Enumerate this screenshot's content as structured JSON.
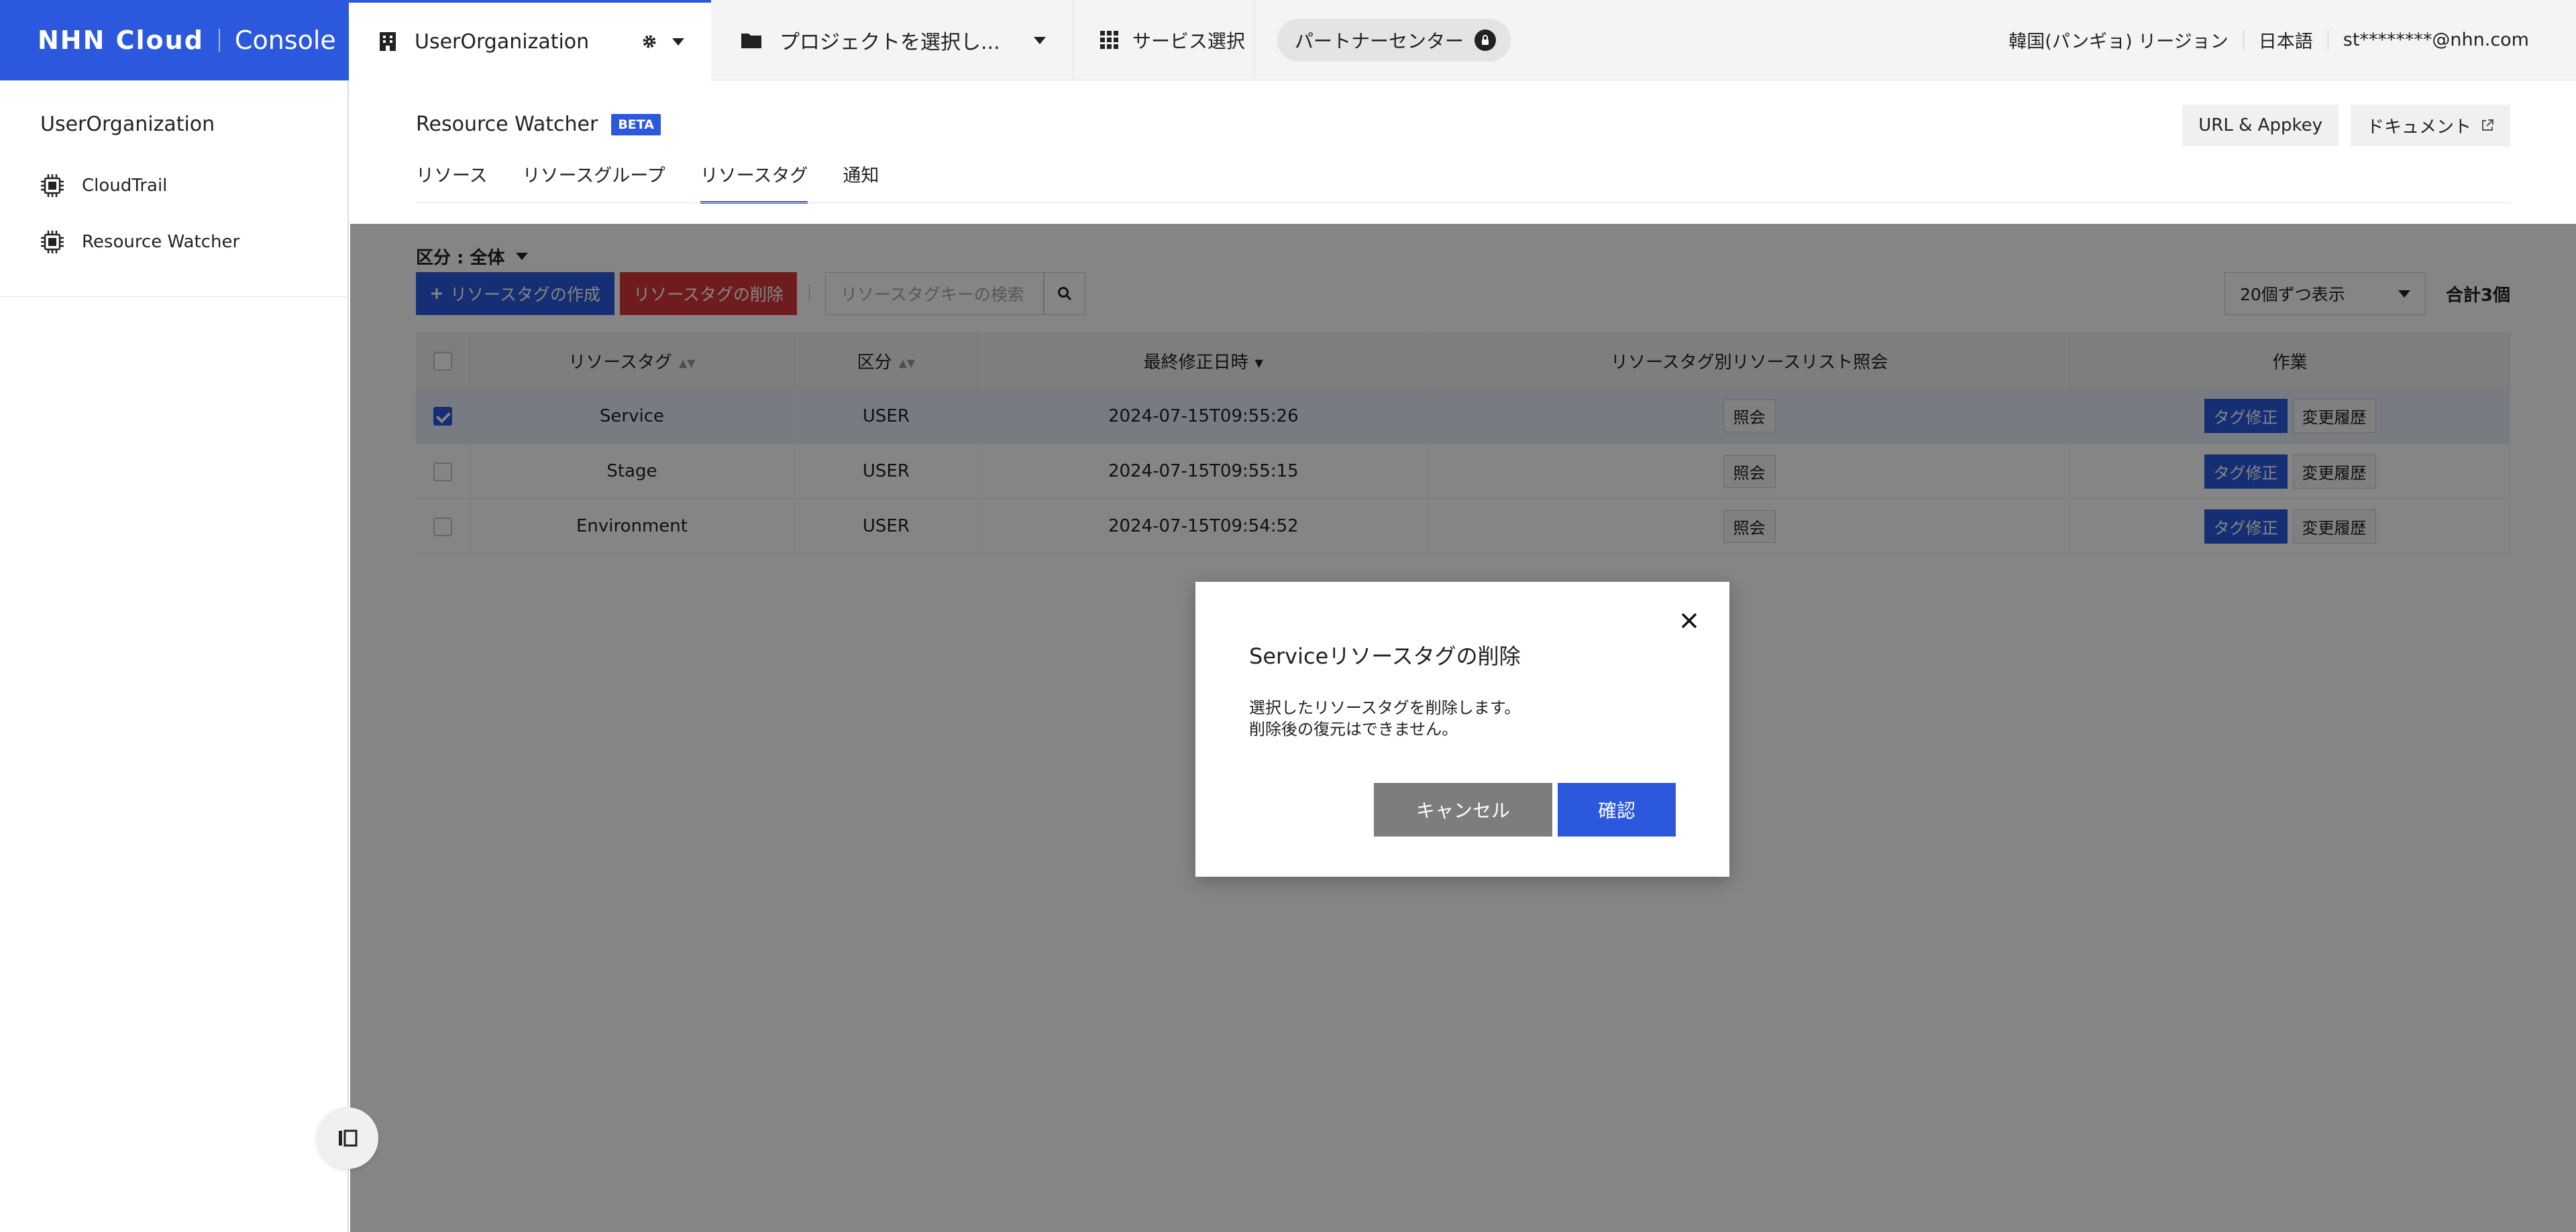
{
  "app": {
    "logo_text": "NHN Cloud",
    "console_text": "Console"
  },
  "topbar": {
    "org_name": "UserOrganization",
    "project_placeholder": "プロジェクトを選択し...",
    "service_select": "サービス選択",
    "partner_center": "パートナーセンター",
    "region": "韓国(パンギョ) リージョン",
    "language": "日本語",
    "user_email": "st********@nhn.com"
  },
  "sidebar": {
    "title": "UserOrganization",
    "items": [
      {
        "label": "CloudTrail",
        "icon": "chip-icon"
      },
      {
        "label": "Resource Watcher",
        "icon": "chip-icon"
      }
    ]
  },
  "header": {
    "title": "Resource Watcher",
    "badge": "BETA",
    "url_appkey": "URL & Appkey",
    "document": "ドキュメント"
  },
  "tabs": [
    {
      "label": "リソース"
    },
    {
      "label": "リソースグループ"
    },
    {
      "label": "リソースタグ",
      "active": true
    },
    {
      "label": "通知"
    }
  ],
  "toolbar": {
    "filter": "区分 : 全体",
    "create": "リソースタグの作成",
    "delete": "リソースタグの削除",
    "search_placeholder": "リソースタグキーの検索",
    "page_size": "20個ずつ表示",
    "total": "合計3個"
  },
  "table": {
    "headers": [
      "リソースタグ",
      "区分",
      "最終修正日時",
      "リソースタグ別リソースリスト照会",
      "作業"
    ],
    "rows": [
      {
        "tag": "Service",
        "type": "USER",
        "modified": "2024-07-15T09:55:26",
        "lookup": "照会",
        "edit": "タグ修正",
        "history": "変更履歴",
        "selected": true
      },
      {
        "tag": "Stage",
        "type": "USER",
        "modified": "2024-07-15T09:55:15",
        "lookup": "照会",
        "edit": "タグ修正",
        "history": "変更履歴",
        "selected": false
      },
      {
        "tag": "Environment",
        "type": "USER",
        "modified": "2024-07-15T09:54:52",
        "lookup": "照会",
        "edit": "タグ修正",
        "history": "変更履歴",
        "selected": false
      }
    ]
  },
  "modal": {
    "title": "Serviceリソースタグの削除",
    "line1": "選択したリソースタグを削除します。",
    "line2": "削除後の復元はできません。",
    "cancel": "キャンセル",
    "confirm": "確認"
  },
  "colors": {
    "primary": "#2b58dd",
    "danger": "#d5373a",
    "cancel": "#7d7d7d"
  }
}
